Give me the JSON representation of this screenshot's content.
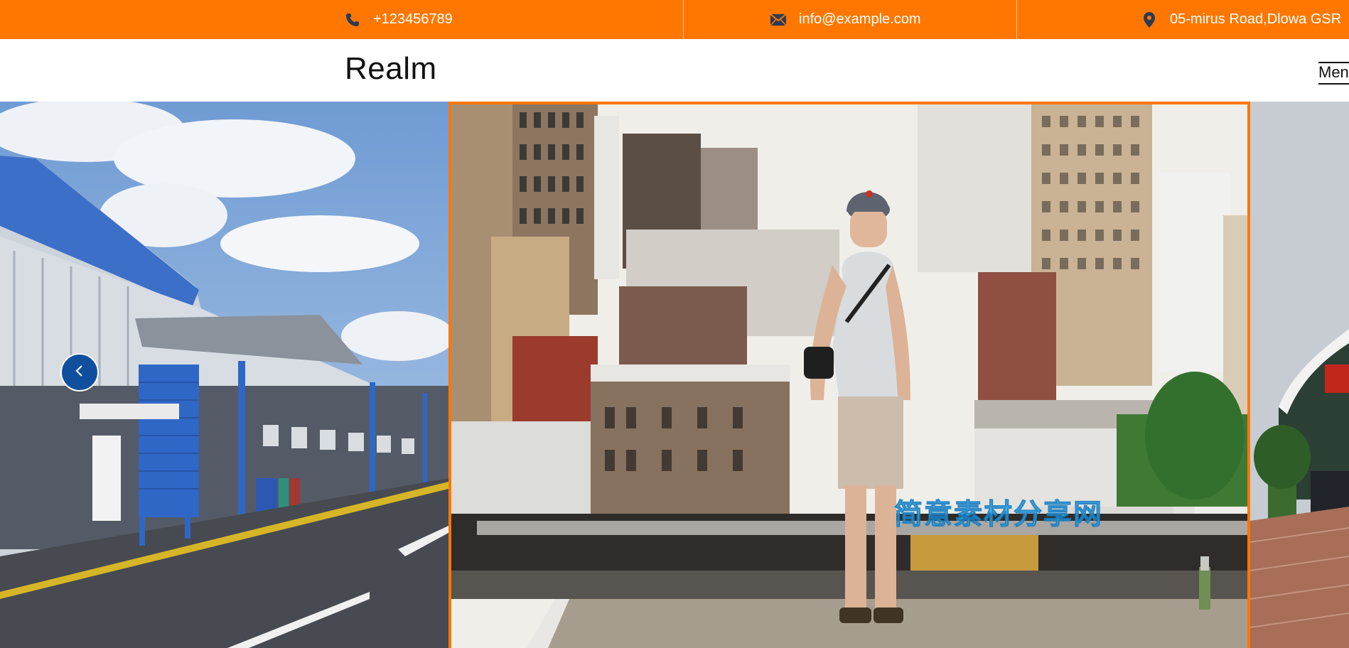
{
  "topbar": {
    "phone": {
      "icon": "phone-icon",
      "text": "+123456789"
    },
    "email": {
      "icon": "envelope-icon",
      "text": "info@example.com"
    },
    "address": {
      "icon": "map-marker-icon",
      "text": "05-mirus Road,Dlowa GSR"
    }
  },
  "header": {
    "brand": "Realm",
    "menu_label": "Menu"
  },
  "slider": {
    "prev_icon": "chevron-left-icon",
    "watermark": "简意素材分享网"
  },
  "colors": {
    "accent": "#ff7700",
    "nav_button": "#0f4f9e"
  }
}
